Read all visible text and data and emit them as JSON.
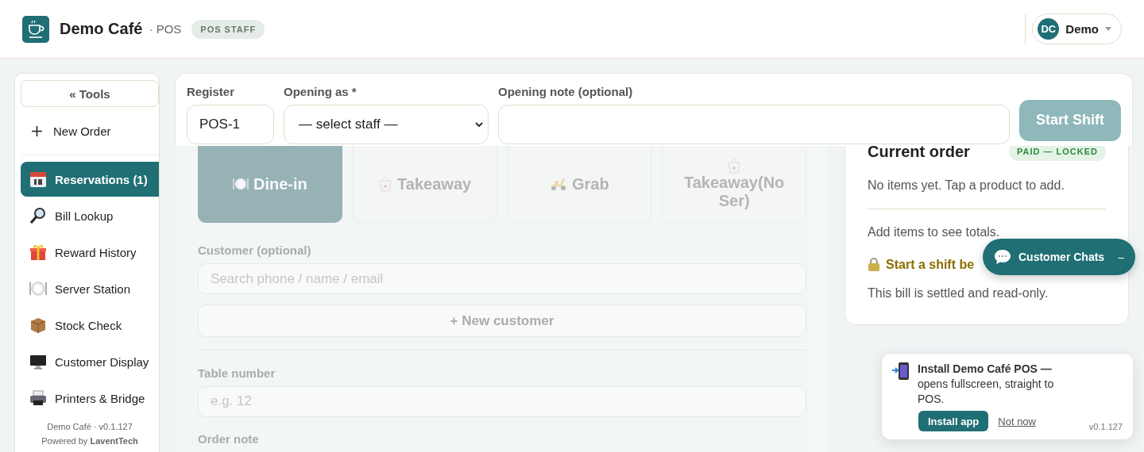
{
  "header": {
    "title": "Demo Café",
    "subtitle": "· POS",
    "role_badge": "POS STAFF",
    "user": {
      "initials": "DC",
      "name": "Demo"
    }
  },
  "sidebar": {
    "tools_button": "« Tools",
    "new_order": "New Order",
    "items": [
      {
        "label": "Reservations (1)",
        "selected": true
      },
      {
        "label": "Bill Lookup",
        "selected": false
      },
      {
        "label": "Reward History",
        "selected": false
      },
      {
        "label": "Server Station",
        "selected": false
      },
      {
        "label": "Stock Check",
        "selected": false
      },
      {
        "label": "Customer Display",
        "selected": false
      },
      {
        "label": "Printers & Bridge",
        "selected": false
      }
    ],
    "version": "Demo Café · v0.1.127",
    "powered_by": "Powered by **LaventTech**"
  },
  "shift_bar": {
    "register_label": "Register",
    "register_value": "POS-1",
    "opening_as_label": "Opening as *",
    "opening_as_value": "— select staff —",
    "note_label": "Opening note (optional)",
    "start_button": "Start Shift",
    "start_disabled": true
  },
  "order_types": [
    {
      "label": "Dine-in",
      "selected": true
    },
    {
      "label": "Takeaway",
      "selected": false
    },
    {
      "label": "Grab",
      "selected": false
    },
    {
      "label": "Takeaway(No Ser)",
      "selected": false
    }
  ],
  "customer": {
    "label": "Customer (optional)",
    "placeholder": "Search phone / name / email",
    "new_button": "+ New customer"
  },
  "table": {
    "label": "Table number",
    "placeholder": "e.g. 12"
  },
  "order_note": {
    "label": "Order note"
  },
  "order_panel": {
    "title": "Current order",
    "badge": "PAID — LOCKED",
    "empty": "No items yet. Tap a product to add.",
    "totals": "Add items to see totals.",
    "warning": "Start a shift be",
    "settled": "This bill is settled and read-only."
  },
  "chat": {
    "label": "Customer Chats",
    "minimize": "–"
  },
  "install": {
    "message": "**Install Demo Café POS —** opens fullscreen, straight to POS.",
    "install_button": "Install app",
    "dismiss": "Not now",
    "version": "v0.1.127"
  }
}
